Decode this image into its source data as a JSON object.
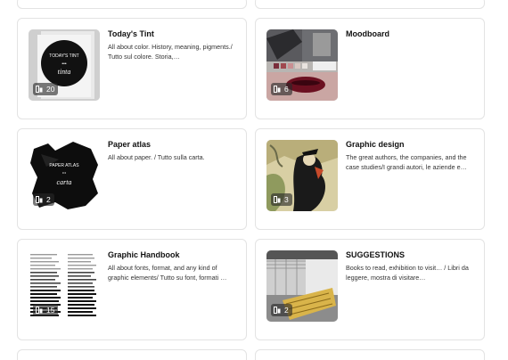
{
  "boards": [
    {
      "title": "Today's Tint",
      "description": "All about color. History, meaning, pigments./ Tutto sul colore. Storia,…",
      "count": "20",
      "thumb_label_top": "TODAY'S TINT",
      "thumb_label_bottom": "tinta"
    },
    {
      "title": "Moodboard",
      "description": "",
      "count": "6"
    },
    {
      "title": "Paper atlas",
      "description": "All about paper. / Tutto sulla carta.",
      "count": "2",
      "thumb_label_top": "PAPER ATLAS",
      "thumb_label_bottom": "carta"
    },
    {
      "title": "Graphic design",
      "description": "The great authors, the companies, and the case studies/I grandi autori, le aziende e…",
      "count": "3"
    },
    {
      "title": "Graphic Handbook",
      "description": "All about fonts, format, and any kind of graphic elements/ Tutto su font, formati …",
      "count": "15"
    },
    {
      "title": "SUGGESTIONS",
      "description": "Books to read, exhibition to visit… / Libri da leggere, mostra di visitare…",
      "count": "2"
    }
  ],
  "colors": {
    "card_border": "#e3e3e3",
    "title": "#111111",
    "description": "#333333",
    "count_badge_bg": "#3a3a3a"
  },
  "icons": {
    "count_badge": "stack-icon"
  }
}
